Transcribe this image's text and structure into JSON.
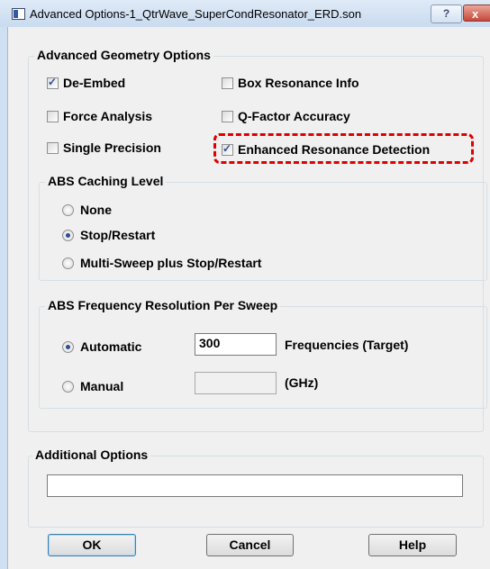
{
  "window": {
    "title": "Advanced Options-1_QtrWave_SuperCondResonator_ERD.son",
    "help_label": "?",
    "close_label": "x"
  },
  "geometry_group": {
    "title": "Advanced Geometry Options",
    "options": [
      {
        "label": "De-Embed",
        "checked": true
      },
      {
        "label": "Box Resonance Info",
        "checked": false
      },
      {
        "label": "Force Analysis",
        "checked": false
      },
      {
        "label": "Q-Factor Accuracy",
        "checked": false
      },
      {
        "label": "Single Precision",
        "checked": false
      },
      {
        "label": "Enhanced Resonance Detection",
        "checked": true
      }
    ],
    "check_glyph": "✓"
  },
  "abs_caching": {
    "title": "ABS Caching Level",
    "options": [
      {
        "label": "None",
        "selected": false
      },
      {
        "label": "Stop/Restart",
        "selected": true
      },
      {
        "label": "Multi-Sweep plus Stop/Restart",
        "selected": false
      }
    ]
  },
  "abs_frequency": {
    "title": "ABS Frequency Resolution Per Sweep",
    "automatic_label": "Automatic",
    "automatic_selected": true,
    "automatic_value": "300",
    "automatic_unit": "Frequencies (Target)",
    "manual_label": "Manual",
    "manual_selected": false,
    "manual_value": "",
    "manual_unit": "(GHz)"
  },
  "additional_options": {
    "title": "Additional Options",
    "value": ""
  },
  "buttons": {
    "ok": "OK",
    "cancel": "Cancel",
    "help": "Help"
  },
  "colors": {
    "highlight": "#e00000",
    "title_bar": "#cfe0f3",
    "close_button": "#c7473a"
  }
}
